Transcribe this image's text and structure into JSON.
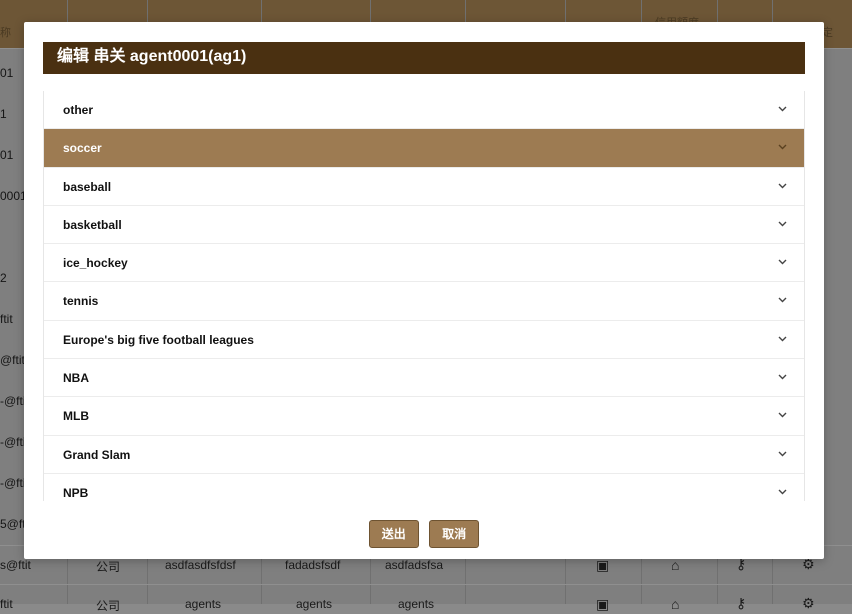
{
  "background": {
    "header_cells": [
      "称",
      "信用額度",
      "定"
    ],
    "left_column": [
      "01",
      "1",
      "01",
      "0001",
      "2",
      "ftit",
      "@ftit",
      "-@ftit",
      "-@ftit",
      "-@ftit",
      "5@ftit",
      "s@ftit",
      "ftit"
    ],
    "row_bottom": {
      "type": "公司",
      "col1": "asdfasdfsfdsf",
      "col2": "fadadsfsdf",
      "col3": "asdfadsfsa"
    },
    "row_last": {
      "type": "公司",
      "col1": "agents",
      "col2": "agents",
      "col3": "agents"
    }
  },
  "modal": {
    "title": "编辑 串关 agent0001(ag1)",
    "items": [
      {
        "label": "other",
        "active": false
      },
      {
        "label": "soccer",
        "active": true
      },
      {
        "label": "baseball",
        "active": false
      },
      {
        "label": "basketball",
        "active": false
      },
      {
        "label": "ice_hockey",
        "active": false
      },
      {
        "label": "tennis",
        "active": false
      },
      {
        "label": "Europe's big five football leagues",
        "active": false
      },
      {
        "label": "NBA",
        "active": false
      },
      {
        "label": "MLB",
        "active": false
      },
      {
        "label": "Grand Slam",
        "active": false
      },
      {
        "label": "NPB",
        "active": false
      }
    ],
    "submit_label": "送出",
    "cancel_label": "取消"
  },
  "colors": {
    "accent": "#9d7b52",
    "title_bar": "#4a3011"
  }
}
